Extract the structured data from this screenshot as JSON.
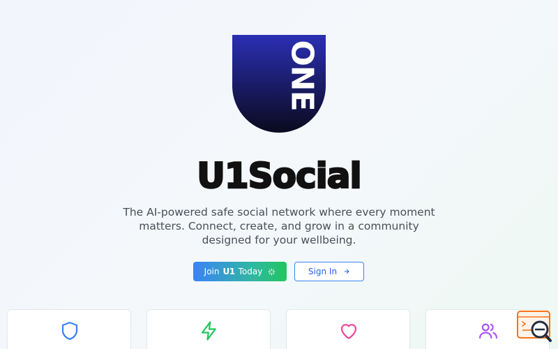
{
  "logo": {
    "text": "ONE",
    "colors": {
      "top": "#2b2fb4",
      "bottom": "#0a0a1e"
    }
  },
  "brand": {
    "title": "U1Social"
  },
  "hero": {
    "tagline": "The AI-powered safe social network where every moment matters. Connect, create, and grow in a community designed for your wellbeing."
  },
  "actions": {
    "join": {
      "prefix": "Join",
      "brand": "U1",
      "suffix": "Today",
      "icon": "sparkle-icon"
    },
    "signin": {
      "label": "Sign In",
      "icon": "arrow-right-icon"
    }
  },
  "features": [
    {
      "icon": "shield-icon",
      "color": "#3b82f6"
    },
    {
      "icon": "lightning-icon",
      "color": "#22c55e"
    },
    {
      "icon": "heart-icon",
      "color": "#ec4899"
    },
    {
      "icon": "users-icon",
      "color": "#a855f7"
    }
  ],
  "widget": {
    "icon": "search-window-icon",
    "accent": "#f97316"
  }
}
